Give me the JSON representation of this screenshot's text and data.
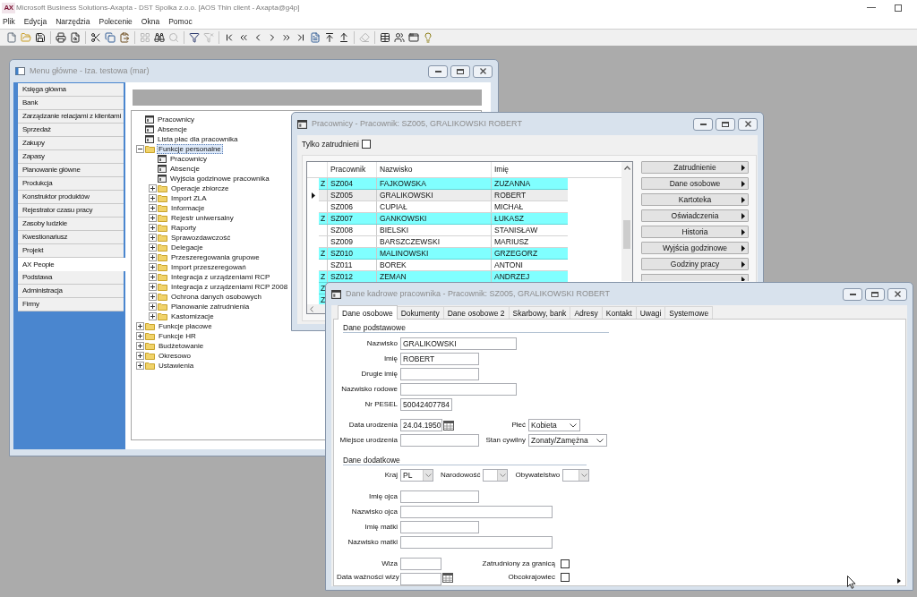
{
  "app": {
    "logo": "AX",
    "title": "Microsoft Business Solutions-Axapta - DST Spolka z.o.o. [AOS Thin client - Axapta@g4p]",
    "menu": [
      "Plik",
      "Edycja",
      "Narzędzia",
      "Polecenie",
      "Okna",
      "Pomoc"
    ],
    "toolbar": [
      [
        {
          "disabled": false
        },
        {
          "disabled": false
        },
        {
          "disabled": false
        }
      ],
      [
        {
          "disabled": false
        },
        {
          "disabled": false
        }
      ],
      [
        {
          "disabled": false
        },
        {
          "disabled": false
        },
        {
          "disabled": false
        }
      ],
      [
        {
          "disabled": true
        },
        {
          "disabled": false
        },
        {
          "disabled": true
        }
      ],
      [
        {
          "disabled": false
        },
        {
          "disabled": true
        }
      ],
      [
        {
          "disabled": false
        },
        {
          "disabled": false
        },
        {
          "disabled": false
        },
        {
          "disabled": false
        },
        {
          "disabled": false
        },
        {
          "disabled": false
        },
        {
          "disabled": false
        },
        {
          "disabled": false
        },
        {
          "disabled": false
        }
      ],
      [
        {
          "disabled": true
        }
      ],
      [
        {
          "disabled": false
        },
        {
          "disabled": false
        },
        {
          "disabled": false
        },
        {
          "disabled": false
        }
      ]
    ]
  },
  "main_menu": {
    "title": "Menu główne - Iza. testowa (mar)",
    "modules": [
      {
        "label": "Księga główna",
        "selected": false
      },
      {
        "label": "Bank",
        "selected": false
      },
      {
        "label": "Zarządzanie relacjami z klientami",
        "selected": false
      },
      {
        "label": "Sprzedaż",
        "selected": false
      },
      {
        "label": "Zakupy",
        "selected": false
      },
      {
        "label": "Zapasy",
        "selected": false
      },
      {
        "label": "Planowanie główne",
        "selected": false
      },
      {
        "label": "Produkcja",
        "selected": false
      },
      {
        "label": "Konstruktor produktów",
        "selected": false
      },
      {
        "label": "Rejestrator czasu pracy",
        "selected": false
      },
      {
        "label": "Zasoby ludzkie",
        "selected": false
      },
      {
        "label": "Kwestionariusz",
        "selected": false
      },
      {
        "label": "Projekt",
        "selected": false
      },
      {
        "label": "AX People",
        "selected": true
      },
      {
        "label": "Podstawa",
        "selected": false
      },
      {
        "label": "Administracja",
        "selected": false
      },
      {
        "label": "Firmy",
        "selected": false
      }
    ],
    "tree": [
      {
        "label": "Pracownicy",
        "kind": "form",
        "selected": false
      },
      {
        "label": "Absencje",
        "kind": "form",
        "selected": false
      },
      {
        "label": "Lista płac dla pracownika",
        "kind": "form",
        "selected": false
      },
      {
        "label": "Funkcje personalne",
        "kind": "folder",
        "expanded": true,
        "selected": true,
        "children": [
          {
            "label": "Pracownicy",
            "kind": "form",
            "selected": false
          },
          {
            "label": "Absencje",
            "kind": "form",
            "selected": false
          },
          {
            "label": "Wyjścia godzinowe pracownika",
            "kind": "form",
            "selected": false
          },
          {
            "label": "Operacje zbiorcze",
            "kind": "folder",
            "expanded": false,
            "selected": false
          },
          {
            "label": "Import ZLA",
            "kind": "folder",
            "expanded": false,
            "selected": false
          },
          {
            "label": "Informacje",
            "kind": "folder",
            "expanded": false,
            "selected": false
          },
          {
            "label": "Rejestr uniwersalny",
            "kind": "folder",
            "expanded": false,
            "selected": false
          },
          {
            "label": "Raporty",
            "kind": "folder",
            "expanded": false,
            "selected": false
          },
          {
            "label": "Sprawozdawczość",
            "kind": "folder",
            "expanded": false,
            "selected": false
          },
          {
            "label": "Delegacje",
            "kind": "folder",
            "expanded": false,
            "selected": false
          },
          {
            "label": "Przeszeregowania grupowe",
            "kind": "folder",
            "expanded": false,
            "selected": false
          },
          {
            "label": "Import przeszeregowań",
            "kind": "folder",
            "expanded": false,
            "selected": false
          },
          {
            "label": "Integracja z urządzeniami RCP",
            "kind": "folder",
            "expanded": false,
            "selected": false
          },
          {
            "label": "Integracja z urządzeniami RCP 2008",
            "kind": "folder",
            "expanded": false,
            "selected": false
          },
          {
            "label": "Ochrona danych osobowych",
            "kind": "folder",
            "expanded": false,
            "selected": false
          },
          {
            "label": "Planowanie zatrudnienia",
            "kind": "folder",
            "expanded": false,
            "selected": false
          },
          {
            "label": "Kastomizacje",
            "kind": "folder",
            "expanded": false,
            "selected": false
          }
        ]
      },
      {
        "label": "Funkcje płacowe",
        "kind": "folder",
        "expanded": false,
        "selected": false
      },
      {
        "label": "Funkcje HR",
        "kind": "folder",
        "expanded": false,
        "selected": false
      },
      {
        "label": "Budżetowanie",
        "kind": "folder",
        "expanded": false,
        "selected": false
      },
      {
        "label": "Okresowo",
        "kind": "folder",
        "expanded": false,
        "selected": false
      },
      {
        "label": "Ustawienia",
        "kind": "folder",
        "expanded": false,
        "selected": false
      }
    ]
  },
  "employees": {
    "title": "Pracownicy - Pracownik: SZ005, GRALIKOWSKI ROBERT",
    "filter": {
      "label": "Tylko zatrudnieni",
      "checked": false
    },
    "columns": [
      "Pracownik",
      "Nazwisko",
      "Imię"
    ],
    "rows": [
      {
        "flag": "Z",
        "highlighted": true,
        "current": false,
        "cells": [
          "SZ004",
          "FAJKOWSKA",
          "ZUZANNA"
        ]
      },
      {
        "highlighted": false,
        "current": true,
        "cells": [
          "SZ005",
          "GRALIKOWSKI",
          "ROBERT"
        ]
      },
      {
        "highlighted": false,
        "current": false,
        "cells": [
          "SZ006",
          "CUPIAŁ",
          "MICHAŁ"
        ]
      },
      {
        "flag": "Z",
        "highlighted": true,
        "current": false,
        "cells": [
          "SZ007",
          "GANKOWSKI",
          "ŁUKASZ"
        ]
      },
      {
        "highlighted": false,
        "current": false,
        "cells": [
          "SZ008",
          "BIELSKI",
          "STANISŁAW"
        ]
      },
      {
        "highlighted": false,
        "current": false,
        "cells": [
          "SZ009",
          "BARSZCZEWSKI",
          "MARIUSZ"
        ]
      },
      {
        "flag": "Z",
        "highlighted": true,
        "current": false,
        "cells": [
          "SZ010",
          "MALINOWSKI",
          "GRZEGORZ"
        ]
      },
      {
        "highlighted": false,
        "current": false,
        "cells": [
          "SZ011",
          "BOREK",
          "ANTONI"
        ]
      },
      {
        "flag": "Z",
        "highlighted": true,
        "current": false,
        "cells": [
          "SZ012",
          "ZEMAN",
          "ANDRZEJ"
        ]
      },
      {
        "flag": "Z",
        "highlighted": true,
        "current": false
      },
      {
        "flag": "Z",
        "highlighted": true,
        "current": false
      }
    ],
    "actions": [
      "Zatrudnienie",
      "Dane osobowe",
      "Kartoteka",
      "Oświadczenia",
      "Historia",
      "Wyjścia godzinowe",
      "Godziny pracy"
    ]
  },
  "employee_details": {
    "title": "Dane kadrowe pracownika - Pracownik: SZ005, GRALIKOWSKI ROBERT",
    "tabs": [
      {
        "label": "Dane osobowe",
        "selected": true
      },
      {
        "label": "Dokumenty",
        "selected": false
      },
      {
        "label": "Dane osobowe 2",
        "selected": false
      },
      {
        "label": "Skarbowy, bank",
        "selected": false
      },
      {
        "label": "Adresy",
        "selected": false
      },
      {
        "label": "Kontakt",
        "selected": false
      },
      {
        "label": "Uwagi",
        "selected": false
      },
      {
        "label": "Systemowe",
        "selected": false
      }
    ],
    "sections": [
      {
        "heading": "Dane podstawowe",
        "fields": [
          {
            "label": "Nazwisko",
            "kind": "text",
            "value": "GRALIKOWSKI"
          },
          {
            "label": "Imię",
            "kind": "text",
            "value": "ROBERT"
          },
          {
            "label": "Drugie imię",
            "kind": "text"
          },
          {
            "label": "Nazwisko rodowe",
            "kind": "text"
          },
          {
            "label": "Nr PESEL",
            "kind": "text",
            "value": "50042407784"
          },
          {
            "label": "Data urodzenia",
            "kind": "date",
            "value": "24.04.1950"
          },
          {
            "label": "Płeć",
            "kind": "select",
            "value": "Kobieta"
          },
          {
            "label": "Miejsce urodzenia",
            "kind": "text"
          },
          {
            "label": "Stan cywilny",
            "kind": "select",
            "value": "Zonaty/Zamężna"
          }
        ]
      },
      {
        "heading": "Dane dodatkowe",
        "fields": [
          {
            "label": "Kraj",
            "kind": "lookup",
            "value": "PL"
          },
          {
            "label": "Narodowość",
            "kind": "lookup"
          },
          {
            "label": "Obywatelstwo",
            "kind": "lookup"
          },
          {
            "label": "Imię ojca",
            "kind": "text"
          },
          {
            "label": "Nazwisko ojca",
            "kind": "text"
          },
          {
            "label": "Imię matki",
            "kind": "text"
          },
          {
            "label": "Nazwisko matki",
            "kind": "text"
          },
          {
            "label": "Wiza",
            "kind": "text"
          },
          {
            "label": "Zatrudniony za granicą",
            "kind": "checkbox",
            "checked": false
          },
          {
            "label": "Data ważności wizy",
            "kind": "date"
          },
          {
            "label": "Obcokrajowiec",
            "kind": "checkbox",
            "checked": false
          }
        ]
      }
    ]
  }
}
